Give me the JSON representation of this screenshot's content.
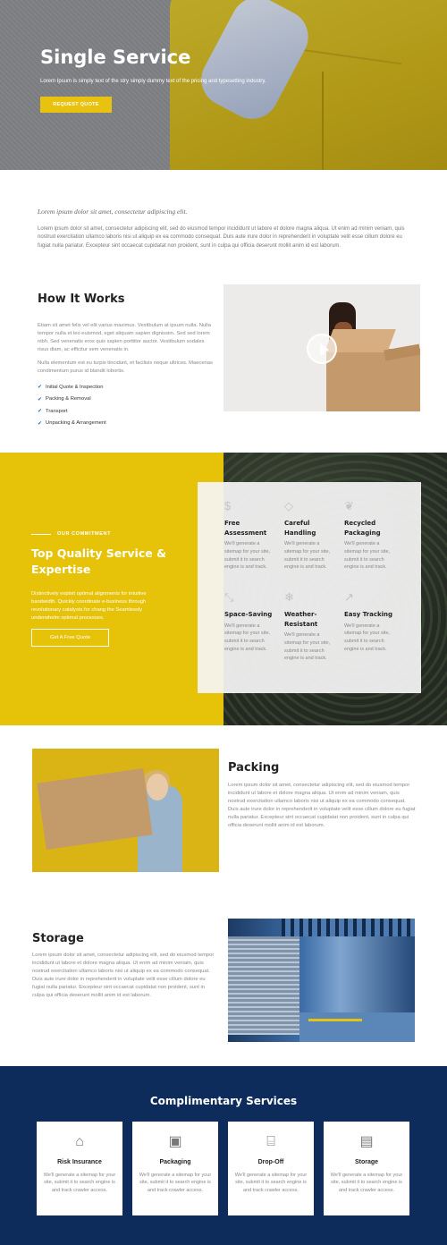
{
  "hero": {
    "title": "Single Service",
    "subtitle": "Lorem Ipsum is simply text of the stry simply dummy text of the pricing and typesetting industry.",
    "button": "REQUEST QUOTE"
  },
  "intro": {
    "lead": "Lorem ipsum dolor sit amet, consectetur adipiscing elit.",
    "body": "Lorem ipsum dolor sit amet, consectetur adipiscing elit, sed do eiusmod tempor incididunt ut labore et dolore magna aliqua. Ut enim ad minim veniam, quis nostrud exercitation ullamco laboris nisi ut aliquip ex ea commodo consequat. Duis aute irure dolor in reprehenderit in voluptate velit esse cillum dolore eu fugiat nulla pariatur. Excepteur sint occaecat cupidatat non proident, sunt in culpa qui officia deserunt mollit anim id est laborum."
  },
  "how_it_works": {
    "title": "How It Works",
    "para1": "Etiam sit amet felis vel elit varius maximus. Vestibulum at ipsum nulla. Nulla tempor nulla et leo euismod, eget aliquam sapien dignissim. Sed sed lorem nibh. Sed venenatis eros quis sapien porttitor auctor. Vestibulum sodales risus diam, ac efficitur sem venenatis in.",
    "para2": "Nulla elementum est eu turpis tincidunt, et facilisis neque ultrices. Maecenas condimentum purus id blandit lobortis.",
    "list": [
      "Initial Quote & Inspection",
      "Packing & Removal",
      "Transport",
      "Unpacking & Arrangement"
    ]
  },
  "commitment": {
    "eyebrow": "OUR COMMITMENT",
    "title": "Top Quality Service & Expertise",
    "body": "Distinctively exploit optimal alignments for intuitive bandwidth. Quickly coordinate e-business through revolutionary catalysts for chang the Seamlessly underwhelm optimal processes.",
    "button": "Get A Free Quote",
    "features": [
      {
        "icon": "dollar-icon",
        "glyph": "$",
        "title": "Free Assessment",
        "text": "We'll generate a sitemap for your site, submit it to search engine is and track."
      },
      {
        "icon": "diamond-icon",
        "glyph": "◇",
        "title": "Careful Handling",
        "text": "We'll generate a sitemap for your site, submit it to search engine is and track."
      },
      {
        "icon": "leaf-icon",
        "glyph": "❦",
        "title": "Recycled Packaging",
        "text": "We'll generate a sitemap for your site, submit it to search engine is and track."
      },
      {
        "icon": "arrows-icon",
        "glyph": "⤡",
        "title": "Space-Saving",
        "text": "We'll generate a sitemap for your site, submit it to search engine is and track."
      },
      {
        "icon": "snowflake-icon",
        "glyph": "❄",
        "title": "Weather-Resistant",
        "text": "We'll generate a sitemap for your site, submit it to search engine is and track."
      },
      {
        "icon": "chart-line-icon",
        "glyph": "↗",
        "title": "Easy Tracking",
        "text": "We'll generate a sitemap for your site, submit it to search engine is and track."
      }
    ]
  },
  "packing": {
    "title": "Packing",
    "body": "Lorem ipsum dolor sit amet, consectetur adipiscing elit, sed do eiusmod tempor incididunt ut labore et dolore magna aliqua. Ut enim ad minim veniam, quis nostrud exercitation ullamco laboris nisi ut aliquip ex ea commodo consequat. Duis aute irure dolor in reprehenderit in voluptate velit esse cillum dolore eu fugiat nulla pariatur. Excepteur sint occaecat cupidatat non proident, sunt in culpa qui officia deserunt mollit anim id est laborum."
  },
  "storage": {
    "title": "Storage",
    "body": "Lorem ipsum dolor sit amet, consectetur adipiscing elit, sed do eiusmod tempor incididunt ut labore et dolore magna aliqua. Ut enim ad minim veniam, quis nostrud exercitation ullamco laboris nisi ut aliquip ex ea commodo consequat. Duis aute irure dolor in reprehenderit in voluptate velit esse cillum dolore eu fugiat nulla pariatur. Excepteur sint occaecat cupidatat non proident, sunt in culpa qui officia deserunt mollit anim id est laborum."
  },
  "complimentary": {
    "title": "Complimentary Services",
    "services": [
      {
        "icon": "house-icon",
        "glyph": "⌂",
        "title": "Risk Insurance",
        "text": "We'll generate a sitemap for your site, submit it to search engine is and track crawler access."
      },
      {
        "icon": "box-icon",
        "glyph": "▣",
        "title": "Packaging",
        "text": "We'll generate a sitemap for your site, submit it to search engine is and track crawler access."
      },
      {
        "icon": "storefront-icon",
        "glyph": "⌸",
        "title": "Drop-Off",
        "text": "We'll generate a sitemap for your site, submit it to search engine is and track crawler access."
      },
      {
        "icon": "archive-box-icon",
        "glyph": "▤",
        "title": "Storage",
        "text": "We'll generate a sitemap for your site, submit it to search engine is and track crawler access."
      }
    ]
  },
  "colors": {
    "accent": "#e6c209",
    "navy": "#0d2c5c",
    "check": "#2b6cc4"
  }
}
